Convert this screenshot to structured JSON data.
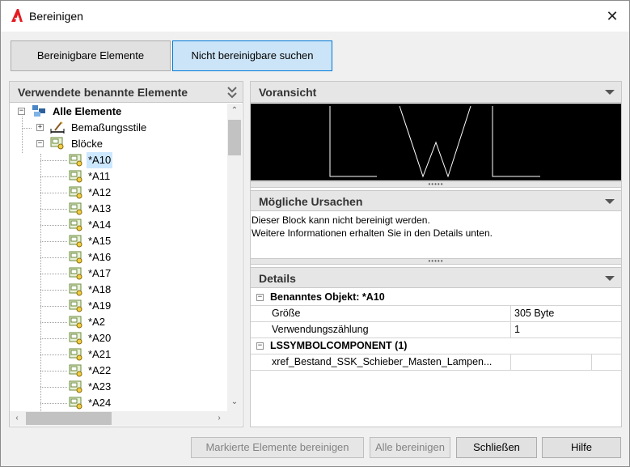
{
  "window": {
    "title": "Bereinigen",
    "close_glyph": "✕",
    "icon": "autocad-logo-icon"
  },
  "tabs": [
    {
      "label": "Bereinigbare Elemente",
      "active": false
    },
    {
      "label": "Nicht bereinigbare suchen",
      "active": true
    }
  ],
  "left_panel": {
    "title": "Verwendete benannte Elemente",
    "tree": {
      "root": "Alle Elemente",
      "groups": [
        {
          "label": "Bemaßungsstile",
          "expanded": false
        },
        {
          "label": "Blöcke",
          "expanded": true
        }
      ],
      "blocks": [
        "*A10",
        "*A11",
        "*A12",
        "*A13",
        "*A14",
        "*A15",
        "*A16",
        "*A17",
        "*A18",
        "*A19",
        "*A2",
        "*A20",
        "*A21",
        "*A22",
        "*A23",
        "*A24"
      ],
      "selected": "*A10"
    }
  },
  "preview": {
    "title": "Voransicht"
  },
  "causes": {
    "title": "Mögliche Ursachen",
    "line1": "Dieser Block kann nicht bereinigt werden.",
    "line2": "Weitere Informationen erhalten Sie in den Details unten."
  },
  "details": {
    "title": "Details",
    "category1": "Benanntes Objekt: *A10",
    "rows1": [
      {
        "label": "Größe",
        "value": "305 Byte"
      },
      {
        "label": "Verwendungszählung",
        "value": "1"
      }
    ],
    "category2": "LSSYMBOLCOMPONENT (1)",
    "rows2": [
      {
        "label": "xref_Bestand_SSK_Schieber_Masten_Lampen...",
        "value": ""
      }
    ]
  },
  "buttons": {
    "purge_selected": "Markierte Elemente bereinigen",
    "purge_all": "Alle bereinigen",
    "close": "Schließen",
    "help": "Hilfe"
  }
}
